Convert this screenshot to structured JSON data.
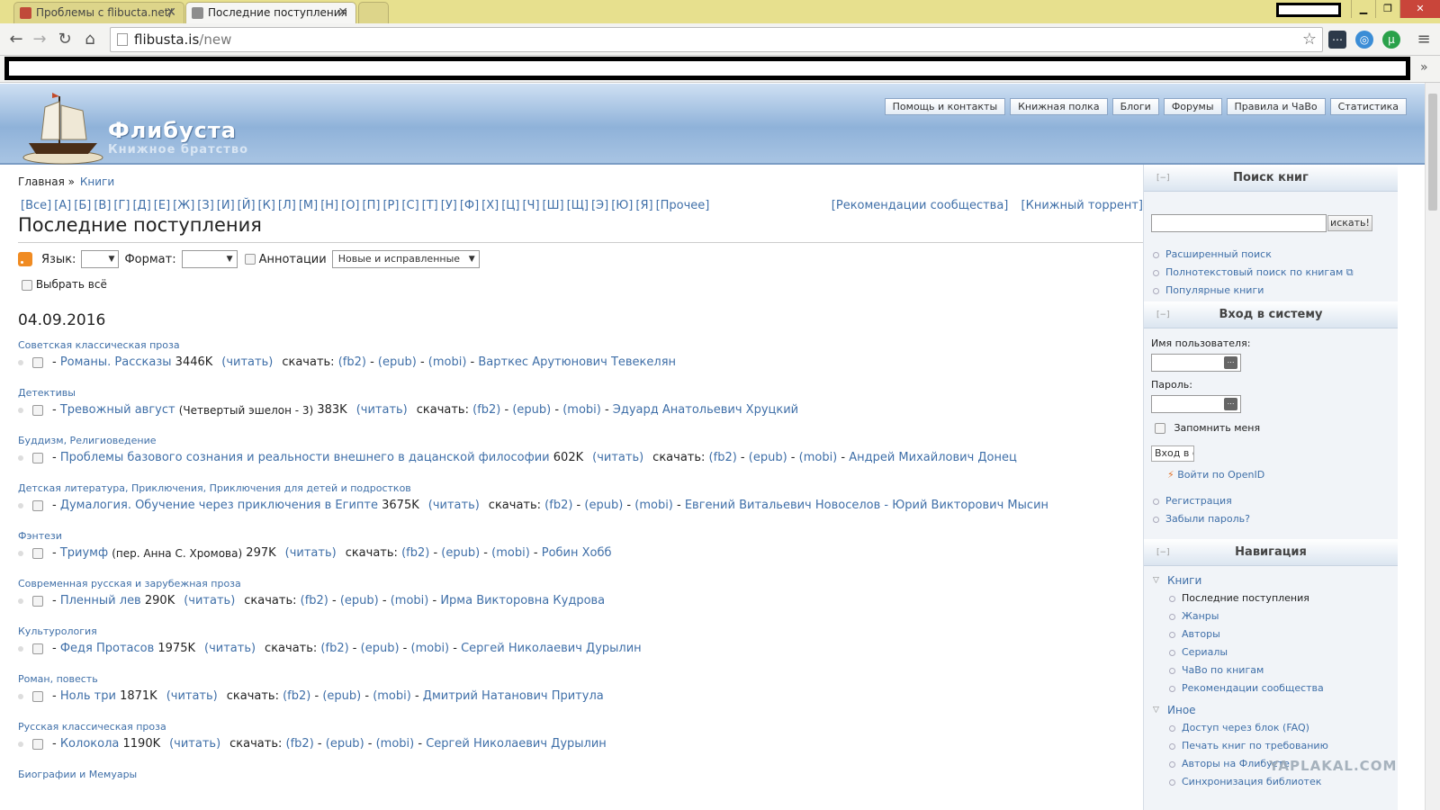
{
  "browser": {
    "tabs": [
      {
        "label": "Проблемы с flibucta.net/"
      },
      {
        "label": "Последние поступления"
      }
    ],
    "window_buttons": {
      "minimize": "▁",
      "maximize": "❐",
      "close": "✕"
    },
    "address": {
      "host": "flibusta.is",
      "path": "/new"
    },
    "bookmarks_more": "»"
  },
  "site": {
    "title": "Флибуста",
    "subtitle": "Книжное братство",
    "menu": [
      "Помощь и контакты",
      "Книжная полка",
      "Блоги",
      "Форумы",
      "Правила и ЧаВо",
      "Статистика"
    ]
  },
  "breadcrumb": {
    "home": "Главная",
    "sep": "»",
    "current": "Книги"
  },
  "alphabet": [
    "[Все]",
    "[А]",
    "[Б]",
    "[В]",
    "[Г]",
    "[Д]",
    "[Е]",
    "[Ж]",
    "[З]",
    "[И]",
    "[Й]",
    "[К]",
    "[Л]",
    "[М]",
    "[Н]",
    "[О]",
    "[П]",
    "[Р]",
    "[С]",
    "[Т]",
    "[У]",
    "[Ф]",
    "[Х]",
    "[Ц]",
    "[Ч]",
    "[Ш]",
    "[Щ]",
    "[Э]",
    "[Ю]",
    "[Я]",
    "[Прочее]"
  ],
  "right_links": [
    "[Рекомендации сообщества]",
    "[Книжный торрент]"
  ],
  "page_title": "Последние поступления",
  "filters": {
    "lang_label": "Язык:",
    "format_label": "Формат:",
    "annotations_label": "Аннотации",
    "sort_value": "Новые и исправленные",
    "select_all": "Выбрать всё"
  },
  "date_heading": "04.09.2016",
  "labels": {
    "read": "(читать)",
    "download": "скачать:",
    "fb2": "(fb2)",
    "epub": "(epub)",
    "mobi": "(mobi)"
  },
  "books": [
    {
      "genre": "Советская классическая проза",
      "title": "Романы. Рассказы",
      "extra": "",
      "size": "3446K",
      "authors": "Варткес Арутюнович Тевекелян"
    },
    {
      "genre": "Детективы",
      "title": "Тревожный август",
      "extra": "(Четвертый эшелон - 3)",
      "size": "383K",
      "authors": "Эдуард Анатольевич Хруцкий"
    },
    {
      "genre": "Буддизм, Религиоведение",
      "title": "Проблемы базового сознания и реальности внешнего в дацанской философии",
      "extra": "",
      "size": "602K",
      "authors": "Андрей Михайлович Донец"
    },
    {
      "genre": "Детская литература, Приключения, Приключения для детей и подростков",
      "title": "Думалогия. Обучение через приключения в Египте",
      "extra": "",
      "size": "3675K",
      "authors": "Евгений Витальевич Новоселов - Юрий Викторович Мысин"
    },
    {
      "genre": "Фэнтези",
      "title": "Триумф",
      "extra": "(пер. Анна С. Хромова)",
      "size": "297K",
      "authors": "Робин Хобб"
    },
    {
      "genre": "Современная русская и зарубежная проза",
      "title": "Пленный лев",
      "extra": "",
      "size": "290K",
      "authors": "Ирма Викторовна Кудрова"
    },
    {
      "genre": "Культурология",
      "title": "Федя Протасов",
      "extra": "",
      "size": "1975K",
      "authors": "Сергей Николаевич Дурылин"
    },
    {
      "genre": "Роман, повесть",
      "title": "Ноль три",
      "extra": "",
      "size": "1871K",
      "authors": "Дмитрий Натанович Притула"
    },
    {
      "genre": "Русская классическая проза",
      "title": "Колокола",
      "extra": "",
      "size": "1190K",
      "authors": "Сергей Николаевич Дурылин"
    },
    {
      "genre": "Биографии и Мемуары",
      "title": "",
      "extra": "",
      "size": "",
      "authors": ""
    }
  ],
  "sidebar": {
    "search": {
      "title": "Поиск книг",
      "toggle": "[−]",
      "button": "искать!",
      "links": [
        "Расширенный поиск",
        "Полнотекстовый поиск по книгам",
        "Популярные книги"
      ]
    },
    "login": {
      "title": "Вход в систему",
      "toggle": "[−]",
      "username_label": "Имя пользователя:",
      "password_label": "Пароль:",
      "remember": "Запомнить меня",
      "button": "Вход в с",
      "openid": "Войти по OpenID",
      "links": [
        "Регистрация",
        "Забыли пароль?"
      ]
    },
    "nav": {
      "title": "Навигация",
      "toggle": "[−]",
      "group1": "Книги",
      "group1_items": [
        "Последние поступления",
        "Жанры",
        "Авторы",
        "Сериалы",
        "ЧаВо по книгам",
        "Рекомендации сообщества"
      ],
      "group2": "Иное",
      "group2_items": [
        "Доступ через блок (FAQ)",
        "Печать книг по требованию",
        "Авторы на Флибусте",
        "Синхронизация библиотек"
      ]
    }
  },
  "watermark": "YAPLAKAL.COM"
}
